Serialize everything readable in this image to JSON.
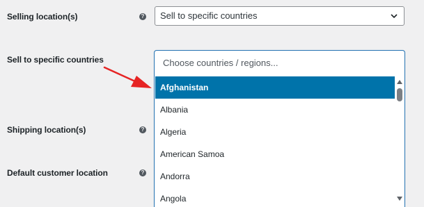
{
  "settings": {
    "selling_location": {
      "label": "Selling location(s)",
      "value": "Sell to specific countries"
    },
    "specific_countries": {
      "label": "Sell to specific countries",
      "search_placeholder": "Choose countries / regions...",
      "options": [
        "Afghanistan",
        "Albania",
        "Algeria",
        "American Samoa",
        "Andorra",
        "Angola"
      ],
      "highlighted": "Afghanistan"
    },
    "shipping_location": {
      "label": "Shipping location(s)"
    },
    "default_customer_location": {
      "label": "Default customer location"
    }
  },
  "help_glyph": "?",
  "colors": {
    "background": "#f0f0f1",
    "highlight": "#0073aa",
    "focus_border": "#2271b1",
    "annotation_arrow": "#e62424"
  },
  "icons": [
    "help-icon",
    "chevron-down-icon",
    "scroll-up-icon",
    "scroll-down-icon",
    "annotation-arrow-icon"
  ]
}
